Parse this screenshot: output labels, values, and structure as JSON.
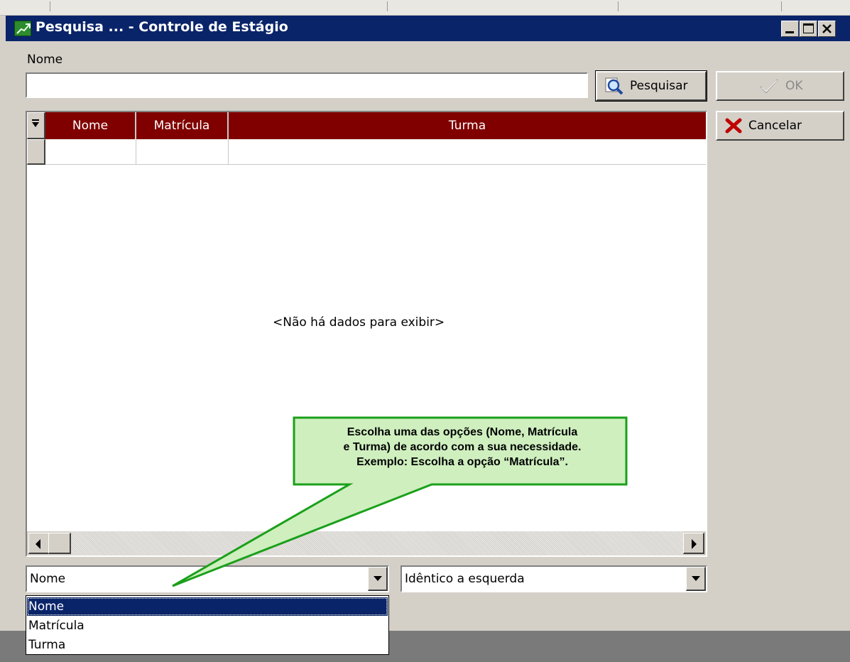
{
  "window": {
    "title": "Pesquisa ... - Controle de Estágio",
    "controls": {
      "minimize": "minimize",
      "maximize": "maximize",
      "close": "close"
    }
  },
  "search": {
    "field_label": "Nome",
    "input_value": "",
    "button_label": "Pesquisar"
  },
  "actions": {
    "ok_label": "OK",
    "ok_enabled": false,
    "cancel_label": "Cancelar"
  },
  "grid": {
    "columns": [
      "Nome",
      "Matrícula",
      "Turma"
    ],
    "empty_message": "<Não há dados para exibir>"
  },
  "filter": {
    "field_selected": "Nome",
    "field_options": [
      "Nome",
      "Matrícula",
      "Turma"
    ],
    "match_selected": "Idêntico a esquerda"
  },
  "callout": {
    "lines": [
      "Escolha uma das opções (Nome, Matrícula",
      "e Turma) de acordo com a sua necessidade.",
      "Exemplo: Escolha a opção “Matrícula”."
    ]
  },
  "colors": {
    "titlebar": "#0a246a",
    "grid_header": "#800000",
    "callout_fill": "#cfefbf",
    "callout_border": "#1aa01a",
    "selection": "#0a246a"
  }
}
